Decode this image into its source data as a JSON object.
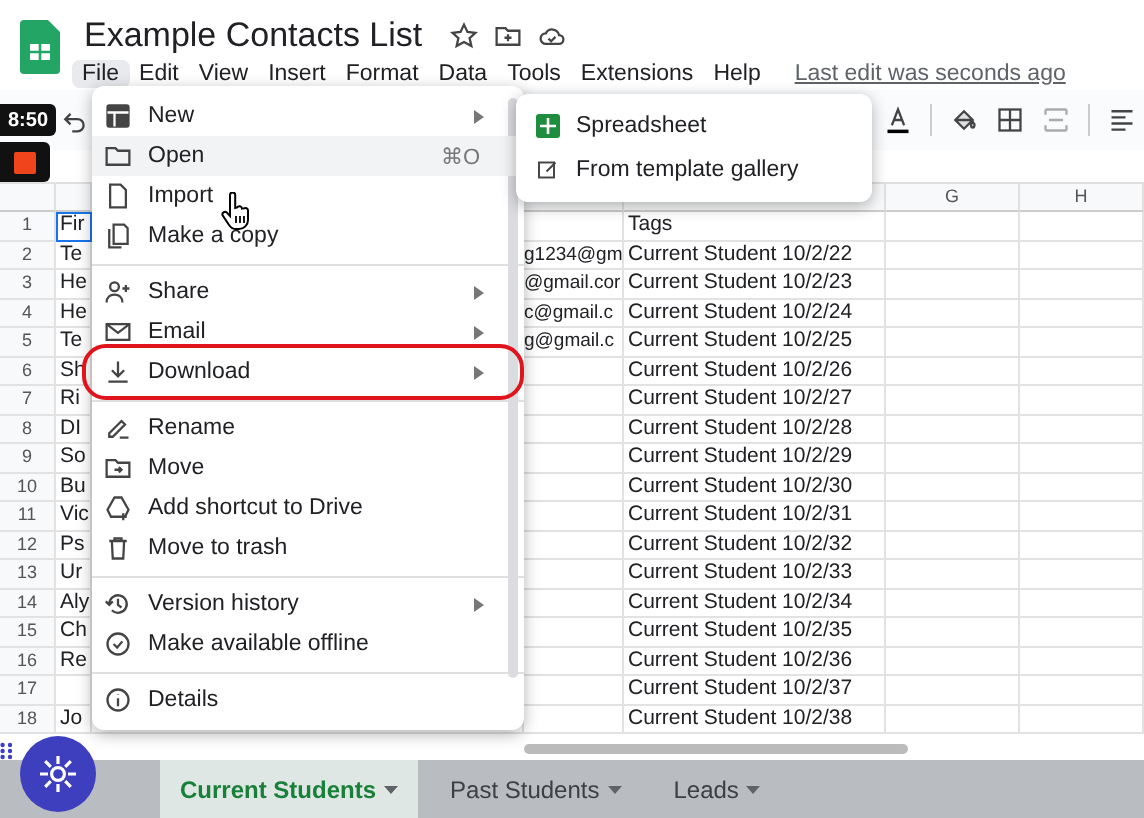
{
  "document": {
    "title": "Example Contacts List",
    "last_edit": "Last edit was seconds ago"
  },
  "menu_bar": [
    {
      "label": "File",
      "selected": true
    },
    {
      "label": "Edit",
      "selected": false
    },
    {
      "label": "View",
      "selected": false
    },
    {
      "label": "Insert",
      "selected": false
    },
    {
      "label": "Format",
      "selected": false
    },
    {
      "label": "Data",
      "selected": false
    },
    {
      "label": "Tools",
      "selected": false
    },
    {
      "label": "Extensions",
      "selected": false
    },
    {
      "label": "Help",
      "selected": false
    }
  ],
  "recorder": {
    "time": "8:50"
  },
  "file_menu": {
    "items": [
      {
        "kind": "item",
        "label": "New",
        "has_submenu": true,
        "hovered": false,
        "circled": false
      },
      {
        "kind": "item",
        "label": "Open",
        "shortcut": "⌘O",
        "has_submenu": false,
        "hovered": true,
        "circled": false
      },
      {
        "kind": "item",
        "label": "Import",
        "has_submenu": false,
        "hovered": false,
        "circled": false
      },
      {
        "kind": "item",
        "label": "Make a copy",
        "has_submenu": false,
        "hovered": false,
        "circled": false
      },
      {
        "kind": "divider"
      },
      {
        "kind": "item",
        "label": "Share",
        "has_submenu": true,
        "hovered": false,
        "circled": false
      },
      {
        "kind": "item",
        "label": "Email",
        "has_submenu": true,
        "hovered": false,
        "circled": false
      },
      {
        "kind": "item",
        "label": "Download",
        "has_submenu": true,
        "hovered": false,
        "circled": true
      },
      {
        "kind": "divider"
      },
      {
        "kind": "item",
        "label": "Rename",
        "has_submenu": false,
        "hovered": false,
        "circled": false
      },
      {
        "kind": "item",
        "label": "Move",
        "has_submenu": false,
        "hovered": false,
        "circled": false
      },
      {
        "kind": "item",
        "label": "Add shortcut to Drive",
        "has_submenu": false,
        "hovered": false,
        "circled": false
      },
      {
        "kind": "item",
        "label": "Move to trash",
        "has_submenu": false,
        "hovered": false,
        "circled": false
      },
      {
        "kind": "divider"
      },
      {
        "kind": "item",
        "label": "Version history",
        "has_submenu": true,
        "hovered": false,
        "circled": false
      },
      {
        "kind": "item",
        "label": "Make available offline",
        "has_submenu": false,
        "hovered": false,
        "circled": false
      },
      {
        "kind": "divider"
      },
      {
        "kind": "item",
        "label": "Details",
        "has_submenu": false,
        "hovered": false,
        "circled": false
      }
    ],
    "submenu": {
      "items": [
        {
          "label": "Spreadsheet"
        },
        {
          "label": "From template gallery"
        }
      ]
    }
  },
  "sheet": {
    "column_headers": [
      "G",
      "H"
    ],
    "rows": [
      {
        "number": "1",
        "column_a": "Fir",
        "email": "",
        "tags": "Tags"
      },
      {
        "number": "2",
        "column_a": "Te",
        "email": "g1234@gm",
        "tags": "Current Student 10/2/22"
      },
      {
        "number": "3",
        "column_a": "He",
        "email": "@gmail.cor",
        "tags": "Current Student 10/2/23"
      },
      {
        "number": "4",
        "column_a": "He",
        "email": "c@gmail.c",
        "tags": "Current Student 10/2/24"
      },
      {
        "number": "5",
        "column_a": "Te",
        "email": "g@gmail.c",
        "tags": "Current Student 10/2/25"
      },
      {
        "number": "6",
        "column_a": "Sh",
        "email": "",
        "tags": "Current Student 10/2/26"
      },
      {
        "number": "7",
        "column_a": "Ri",
        "email": "",
        "tags": "Current Student 10/2/27"
      },
      {
        "number": "8",
        "column_a": "DI",
        "email": "",
        "tags": "Current Student 10/2/28"
      },
      {
        "number": "9",
        "column_a": "So",
        "email": "",
        "tags": "Current Student 10/2/29"
      },
      {
        "number": "10",
        "column_a": "Bu",
        "email": "",
        "tags": "Current Student 10/2/30"
      },
      {
        "number": "11",
        "column_a": "Vic",
        "email": "",
        "tags": "Current Student 10/2/31"
      },
      {
        "number": "12",
        "column_a": "Ps",
        "email": "",
        "tags": "Current Student 10/2/32"
      },
      {
        "number": "13",
        "column_a": "Ur",
        "email": "",
        "tags": "Current Student 10/2/33"
      },
      {
        "number": "14",
        "column_a": "Aly",
        "email": "",
        "tags": "Current Student 10/2/34"
      },
      {
        "number": "15",
        "column_a": "Ch",
        "email": "",
        "tags": "Current Student 10/2/35"
      },
      {
        "number": "16",
        "column_a": "Re",
        "email": "",
        "tags": "Current Student 10/2/36"
      },
      {
        "number": "17",
        "column_a": "",
        "email": "",
        "tags": "Current Student 10/2/37"
      },
      {
        "number": "18",
        "column_a": "Jo",
        "email": "",
        "tags": "Current Student 10/2/38"
      }
    ]
  },
  "sheet_tabs": [
    {
      "label": "Current Students",
      "selected": true
    },
    {
      "label": "Past Students",
      "selected": false
    },
    {
      "label": "Leads",
      "selected": false
    }
  ]
}
